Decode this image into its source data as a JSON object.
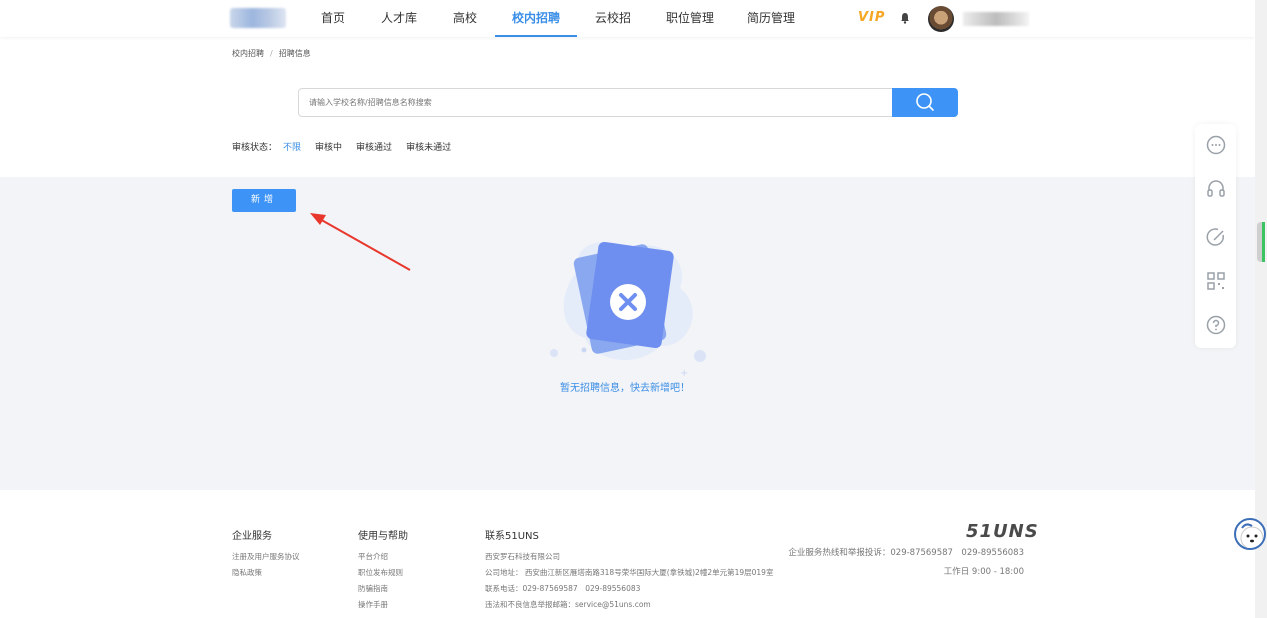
{
  "nav": {
    "items": [
      {
        "label": "首页"
      },
      {
        "label": "人才库"
      },
      {
        "label": "高校"
      },
      {
        "label": "校内招聘"
      },
      {
        "label": "云校招"
      },
      {
        "label": "职位管理"
      },
      {
        "label": "简历管理"
      }
    ],
    "active_index": 3,
    "vip_label": "VIP"
  },
  "breadcrumb": {
    "items": [
      "校内招聘",
      "招聘信息"
    ],
    "separator": "/"
  },
  "search": {
    "placeholder": "请输入学校名称/招聘信息名称搜索"
  },
  "filter": {
    "label": "审核状态：",
    "options": [
      "不限",
      "审核中",
      "审核通过",
      "审核未通过"
    ],
    "active_index": 0
  },
  "main": {
    "add_button_label": "新增",
    "empty_text": "暂无招聘信息，快去新增吧！"
  },
  "side_toolbar": {
    "icons": [
      "chat-icon",
      "headset-icon",
      "edit-icon",
      "qrcode-icon",
      "help-icon"
    ]
  },
  "footer": {
    "col1": {
      "title": "企业服务",
      "links": [
        "注册及用户服务协议",
        "隐私政策"
      ]
    },
    "col2": {
      "title": "使用与帮助",
      "links": [
        "平台介绍",
        "职位发布规则",
        "防骗指南",
        "操作手册"
      ]
    },
    "col3": {
      "title": "联系51UNS",
      "lines": [
        "西安罗石科技有限公司",
        "公司地址： 西安曲江新区雁塔南路318号荣华国际大厦(拿铁城)2幢2单元第19层019室",
        "联系电话：029-87569587　029-89556083",
        "违法和不良信息举报邮箱：service@51uns.com"
      ]
    },
    "brand": "51UNS",
    "hotline": "企业服务热线和举报投诉：029-87569587　029-89556083",
    "workday": "工作日 9:00 - 18:00"
  },
  "colors": {
    "accent": "#3d94f6",
    "vip": "#f5a623",
    "content_bg": "#f3f4f7"
  }
}
